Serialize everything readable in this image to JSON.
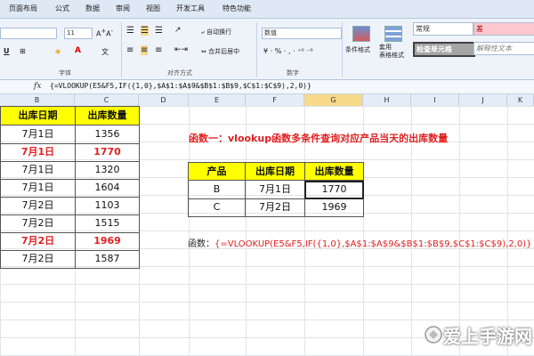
{
  "menu": [
    "页面布局",
    "公式",
    "数据",
    "审阅",
    "视图",
    "开发工具",
    "特色功能"
  ],
  "ribbon": {
    "font_size": "11",
    "number_format": "数值",
    "wrap_text": "自动换行",
    "merge_center": "合并后居中",
    "conditional_format": "条件格式",
    "table_format": "套用\n表格格式",
    "style_normal": "常规",
    "style_bad": "差",
    "style_check": "检查单元格",
    "style_explain": "解释性文本",
    "group_font": "字体",
    "group_align": "对齐方式",
    "group_number": "数字"
  },
  "formula_bar": {
    "fx": "fx",
    "formula": "{=VLOOKUP(E5&F5,IF({1,0},$A$1:$A$9&$B$1:$B$9,$C$1:$C$9),2,0)}"
  },
  "columns": [
    "B",
    "C",
    "D",
    "E",
    "F",
    "G",
    "H",
    "I",
    "J",
    "K"
  ],
  "left_table": {
    "headers": [
      "出库日期",
      "出库数量"
    ],
    "rows": [
      {
        "date": "7月1日",
        "qty": "1356",
        "highlight": false
      },
      {
        "date": "7月1日",
        "qty": "1770",
        "highlight": true
      },
      {
        "date": "7月1日",
        "qty": "1320",
        "highlight": false
      },
      {
        "date": "7月1日",
        "qty": "1604",
        "highlight": false
      },
      {
        "date": "7月2日",
        "qty": "1103",
        "highlight": false
      },
      {
        "date": "7月2日",
        "qty": "1515",
        "highlight": false
      },
      {
        "date": "7月2日",
        "qty": "1969",
        "highlight": true
      },
      {
        "date": "7月2日",
        "qty": "1587",
        "highlight": false
      }
    ]
  },
  "title": "函数一：vlookup函数多条件查询对应产品当天的出库数量",
  "lookup_table": {
    "headers": [
      "产品",
      "出库日期",
      "出库数量"
    ],
    "rows": [
      [
        "B",
        "7月1日",
        "1770"
      ],
      [
        "C",
        "7月2日",
        "1969"
      ]
    ]
  },
  "formula_note": {
    "label": "函数：",
    "text": "{=VLOOKUP(E5&F5,IF({1,0},$A$1:$A$9&$B$1:$B$9,$C$1:$C$9),2,0)}"
  },
  "watermark": "爱上手游网",
  "colors": {
    "header_fill": "#ffff00",
    "accent_red": "#e02020"
  }
}
